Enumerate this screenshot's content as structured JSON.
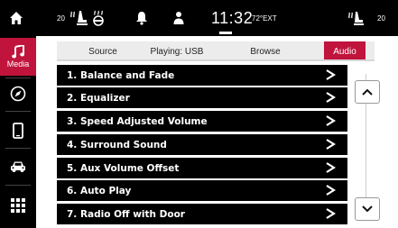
{
  "status_bar": {
    "left_temp": "20",
    "clock": "11:32",
    "outside_temp": "72°EXT",
    "right_temp": "20"
  },
  "sidebar": {
    "items": [
      {
        "icon": "home-icon"
      },
      {
        "icon": "music-note-icon",
        "label": "Media",
        "active": true
      },
      {
        "icon": "compass-icon"
      },
      {
        "icon": "phone-icon"
      },
      {
        "icon": "car-icon"
      },
      {
        "icon": "apps-grid-icon"
      }
    ]
  },
  "tabs": [
    {
      "label": "Source"
    },
    {
      "label": "Playing: USB"
    },
    {
      "label": "Browse"
    },
    {
      "label": "Audio",
      "active": true
    }
  ],
  "list": {
    "items": [
      {
        "label": "1. Balance and Fade"
      },
      {
        "label": "2. Equalizer"
      },
      {
        "label": "3. Speed Adjusted Volume"
      },
      {
        "label": "4. Surround Sound"
      },
      {
        "label": "5. Aux Volume Offset"
      },
      {
        "label": "6. Auto Play"
      },
      {
        "label": "7. Radio Off with Door"
      }
    ],
    "chevron": ">"
  },
  "scroll": {
    "up_icon": "chevron-up-icon",
    "down_icon": "chevron-down-icon"
  },
  "colors": {
    "accent": "#c0143c",
    "bar": "#000000",
    "background": "#ffffff"
  }
}
